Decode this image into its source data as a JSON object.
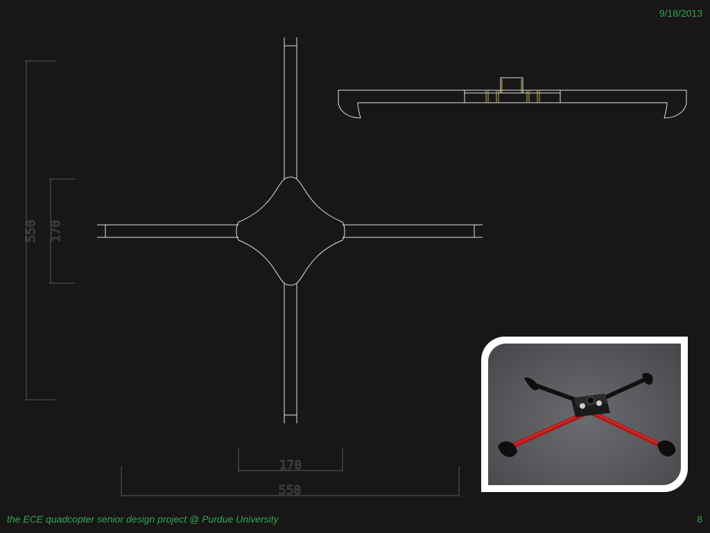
{
  "header": {
    "date": "9/18/2013"
  },
  "drawing": {
    "top_view_dims": {
      "overall_vertical": "550",
      "center_vertical": "170",
      "center_horizontal": "170",
      "overall_horizontal": "550"
    }
  },
  "photo": {
    "subject": "quadcopter frame"
  },
  "footer": {
    "text": "the ECE quadcopter senior design project @ Purdue University",
    "page_number": "8"
  },
  "colors": {
    "accent": "#2fa84f",
    "background": "#181617",
    "line": "#e6e6e6",
    "dim": "#4a4a4a",
    "arm_red": "#c81e1e"
  },
  "icons": []
}
